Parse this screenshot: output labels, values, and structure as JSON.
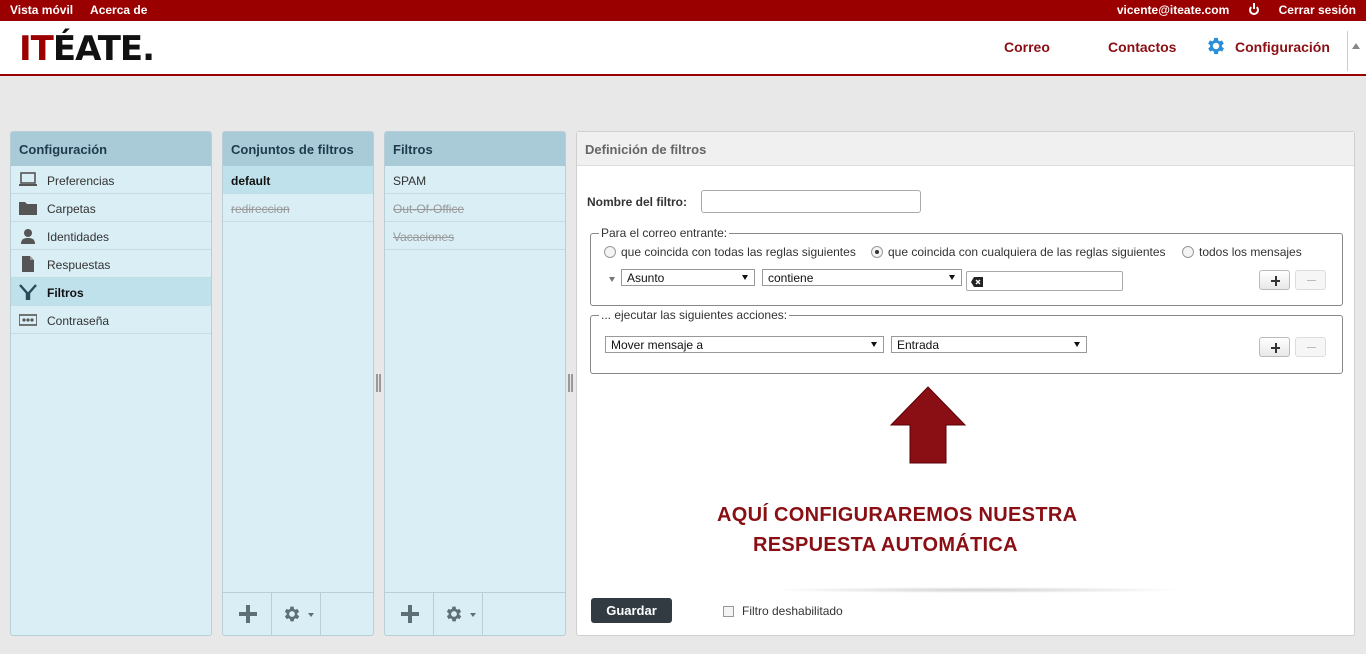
{
  "topbar": {
    "mobile_view": "Vista móvil",
    "about": "Acerca de",
    "user_email": "vicente@iteate.com",
    "logout": "Cerrar sesión"
  },
  "logo": {
    "prefix": "IT",
    "rest": "ÉATE."
  },
  "nav": {
    "mail": "Correo",
    "contacts": "Contactos",
    "settings": "Configuración"
  },
  "settings_panel": {
    "title": "Configuración",
    "items": [
      {
        "label": "Preferencias",
        "icon": "monitor-icon"
      },
      {
        "label": "Carpetas",
        "icon": "folder-icon"
      },
      {
        "label": "Identidades",
        "icon": "person-icon"
      },
      {
        "label": "Respuestas",
        "icon": "document-icon"
      },
      {
        "label": "Filtros",
        "icon": "filter-icon",
        "selected": true
      },
      {
        "label": "Contraseña",
        "icon": "password-icon"
      }
    ]
  },
  "filter_sets_panel": {
    "title": "Conjuntos de filtros",
    "items": [
      {
        "label": "default",
        "selected": true
      },
      {
        "label": "redireccion",
        "disabled": true
      }
    ]
  },
  "filters_panel": {
    "title": "Filtros",
    "items": [
      {
        "label": "SPAM"
      },
      {
        "label": "Out-Of-Office",
        "disabled": true
      },
      {
        "label": "Vacaciones",
        "disabled": true
      }
    ]
  },
  "definition": {
    "title": "Definición de filtros",
    "name_label": "Nombre del filtro:",
    "name_value": "",
    "incoming_legend": "Para el correo entrante:",
    "radio_all": "que coincida con todas las reglas siguientes",
    "radio_any": "que coincida con cualquiera de las reglas siguientes",
    "radio_every": "todos los mensajes",
    "rule_header": "Asunto",
    "rule_op": "contiene",
    "rule_value": "",
    "actions_legend": "... ejecutar las siguientes acciones:",
    "action_type": "Mover mensaje a",
    "action_target": "Entrada",
    "annotation_line1": "AQUÍ CONFIGURAREMOS NUESTRA",
    "annotation_line2": "RESPUESTA AUTOMÁTICA",
    "save": "Guardar",
    "disabled_label": "Filtro deshabilitado"
  },
  "colors": {
    "brand": "#9b0000",
    "nav_text": "#8a0f14",
    "panel_bg": "#d9eef5",
    "panel_head": "#a9cbd8",
    "gear_blue": "#2a8fd6"
  }
}
